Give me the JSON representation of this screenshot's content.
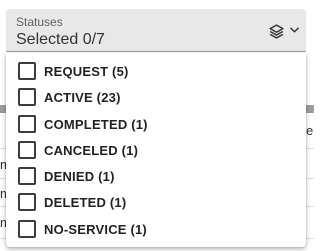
{
  "status_filter": {
    "label": "Statuses",
    "value": "Selected 0/7",
    "icons": {
      "stack": "layers-icon",
      "toggle": "chevron-down-icon"
    },
    "options": [
      {
        "label": "REQUEST (5)",
        "checked": false
      },
      {
        "label": "ACTIVE (23)",
        "checked": false
      },
      {
        "label": "COMPLETED (1)",
        "checked": false
      },
      {
        "label": "CANCELED (1)",
        "checked": false
      },
      {
        "label": "DENIED (1)",
        "checked": false
      },
      {
        "label": "DELETED (1)",
        "checked": false
      },
      {
        "label": "NO-SERVICE (1)",
        "checked": false
      }
    ]
  },
  "background": {
    "right_fragment": "e",
    "left_fragments": [
      "m",
      "m",
      "m"
    ]
  }
}
